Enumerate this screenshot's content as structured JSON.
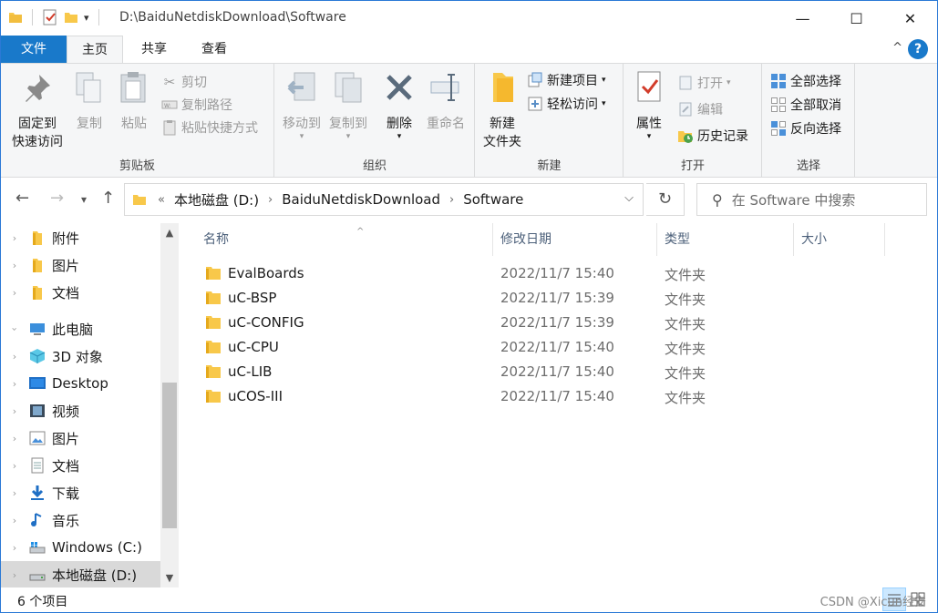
{
  "titlebar": {
    "path": "D:\\BaiduNetdiskDownload\\Software",
    "minimize": "—",
    "maximize": "☐",
    "close": "✕"
  },
  "tabs": {
    "file": "文件",
    "home": "主页",
    "share": "共享",
    "view": "查看",
    "collapse": "^",
    "help": "?"
  },
  "ribbon": {
    "clipboard": {
      "label": "剪贴板",
      "pin": "固定到\n快速访问",
      "pin_line1": "固定到",
      "pin_line2": "快速访问",
      "copy": "复制",
      "paste": "粘贴",
      "cut": "剪切",
      "copy_path": "复制路径",
      "paste_shortcut": "粘贴快捷方式"
    },
    "organize": {
      "label": "组织",
      "move_to": "移动到",
      "copy_to": "复制到",
      "delete": "删除",
      "rename": "重命名"
    },
    "new": {
      "label": "新建",
      "new_folder_line1": "新建",
      "new_folder_line2": "文件夹",
      "new_item": "新建项目",
      "easy_access": "轻松访问"
    },
    "open": {
      "label": "打开",
      "properties": "属性",
      "open": "打开",
      "edit": "编辑",
      "history": "历史记录"
    },
    "select": {
      "label": "选择",
      "select_all": "全部选择",
      "select_none": "全部取消",
      "invert": "反向选择"
    }
  },
  "address": {
    "overflow": "«",
    "crumbs": [
      "本地磁盘 (D:)",
      "BaiduNetdiskDownload",
      "Software"
    ],
    "search_placeholder": "在 Software 中搜索"
  },
  "sidebar": {
    "items": [
      {
        "label": "附件",
        "icon": "folder-icon"
      },
      {
        "label": "图片",
        "icon": "folder-icon"
      },
      {
        "label": "文档",
        "icon": "folder-icon"
      },
      {
        "label": "此电脑",
        "icon": "computer-icon"
      },
      {
        "label": "3D 对象",
        "icon": "3d-objects-icon"
      },
      {
        "label": "Desktop",
        "icon": "desktop-icon"
      },
      {
        "label": "视频",
        "icon": "video-icon"
      },
      {
        "label": "图片",
        "icon": "pictures-icon"
      },
      {
        "label": "文档",
        "icon": "documents-icon"
      },
      {
        "label": "下载",
        "icon": "download-icon"
      },
      {
        "label": "音乐",
        "icon": "music-icon"
      },
      {
        "label": "Windows (C:)",
        "icon": "drive-icon"
      },
      {
        "label": "本地磁盘 (D:)",
        "icon": "drive-icon"
      }
    ]
  },
  "columns": {
    "name": "名称",
    "date": "修改日期",
    "type": "类型",
    "size": "大小"
  },
  "files": [
    {
      "name": "EvalBoards",
      "date": "2022/11/7 15:40",
      "type": "文件夹"
    },
    {
      "name": "uC-BSP",
      "date": "2022/11/7 15:39",
      "type": "文件夹"
    },
    {
      "name": "uC-CONFIG",
      "date": "2022/11/7 15:39",
      "type": "文件夹"
    },
    {
      "name": "uC-CPU",
      "date": "2022/11/7 15:40",
      "type": "文件夹"
    },
    {
      "name": "uC-LIB",
      "date": "2022/11/7 15:40",
      "type": "文件夹"
    },
    {
      "name": "uCOS-III",
      "date": "2022/11/7 15:40",
      "type": "文件夹"
    }
  ],
  "status": {
    "count": "6 个项目",
    "watermark": "CSDN @Xicun经安"
  },
  "colors": {
    "accent": "#1979ca",
    "folder": "#f8c84a",
    "selected": "#cce8ff"
  }
}
